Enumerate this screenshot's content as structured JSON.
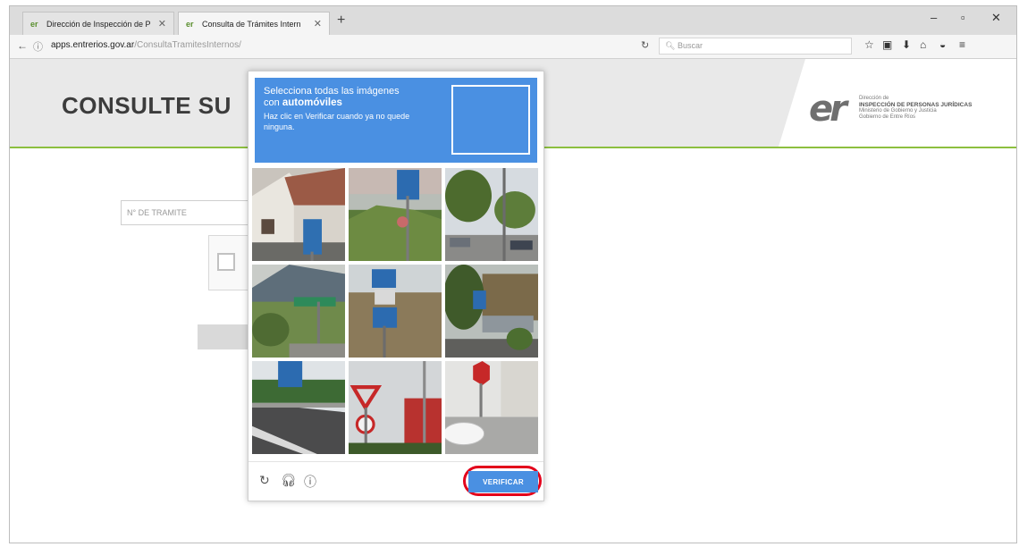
{
  "browser": {
    "tabs": [
      {
        "label": "Dirección de Inspección de P",
        "favicon": "er"
      },
      {
        "label": "Consulta de Trámites Intern",
        "favicon": "er"
      }
    ],
    "url_host": "apps.entrerios.gov.ar",
    "url_path": "/ConsultaTramitesInternos/",
    "url_prefix": "",
    "search_placeholder": "Buscar"
  },
  "page": {
    "title": "CONSULTE SU",
    "tramite_placeholder": "N° DE TRAMITE",
    "logo": {
      "line1": "Dirección de",
      "line2": "INSPECCIÓN DE PERSONAS JURÍDICAS",
      "line3": "Ministerio de Gobierno y Justicia",
      "line4": "Gobierno de Entre Ríos"
    }
  },
  "captcha": {
    "instruction_line1": "Selecciona todas las imágenes",
    "instruction_con": "con",
    "keyword": "automóviles",
    "instruction_sub": "Haz clic en Verificar cuando ya no quede ninguna.",
    "verify_label": "VERIFICAR",
    "colors": {
      "header": "#4a90e2",
      "highlight": "#e3001b"
    },
    "tiles": [
      "house-street-sign",
      "blue-sign-field",
      "trees-parked-cars",
      "street-sign-houses",
      "field-blue-signs",
      "tree-car-street",
      "road-blue-sign",
      "stop-yield-signs",
      "stop-sign-car"
    ]
  }
}
